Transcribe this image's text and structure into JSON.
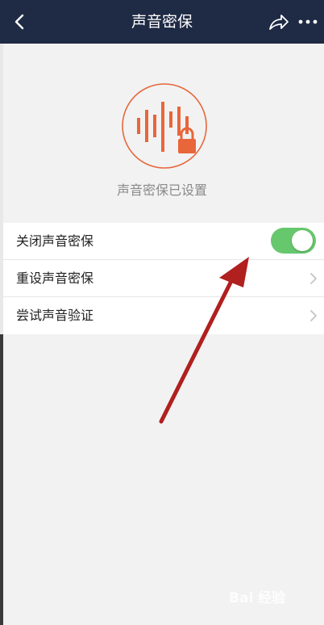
{
  "navbar": {
    "title": "声音密保",
    "back_icon": "back-arrow-icon",
    "share_icon": "share-icon",
    "more_icon": "more-dots-icon",
    "background": "#1f2a44"
  },
  "hero": {
    "icon": "voice-lock-icon",
    "status_text": "声音密保已设置",
    "accent_color": "#e8663a"
  },
  "settings": {
    "items": [
      {
        "label": "关闭声音密保",
        "control": "toggle",
        "toggle_on": true
      },
      {
        "label": "重设声音密保",
        "control": "chevron"
      },
      {
        "label": "尝试声音验证",
        "control": "chevron"
      }
    ]
  },
  "colors": {
    "toggle_on": "#67c76d",
    "annotation_arrow": "#b0201f"
  },
  "watermark": {
    "text": "Bai 经验"
  }
}
